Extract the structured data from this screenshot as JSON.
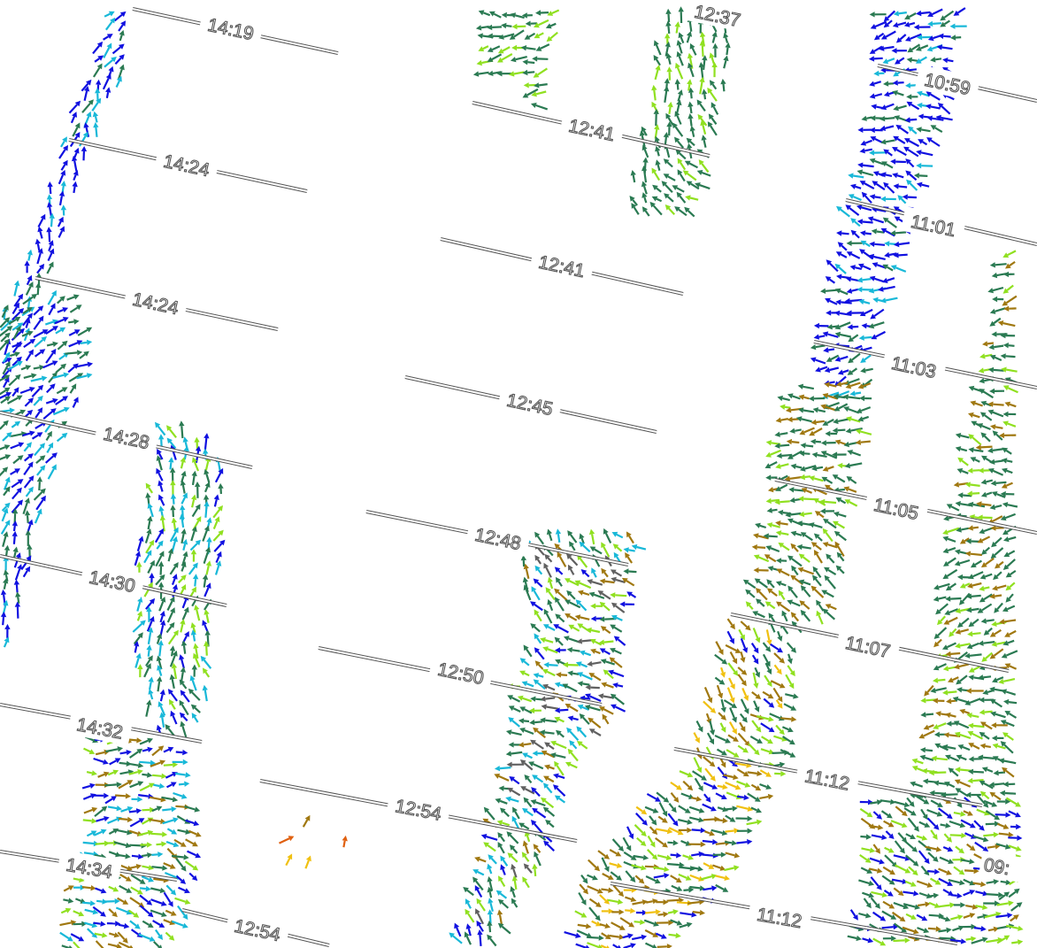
{
  "map": {
    "description_free": true,
    "track_label_color": "#555555",
    "vector_palette": {
      "blue": "#1010e0",
      "cyan": "#18b8d8",
      "dark_green": "#2a7a52",
      "light_green": "#90e020",
      "ochre": "#a07810",
      "yellow": "#f0c010",
      "orange": "#e06010",
      "gray": "#606060"
    },
    "swaths": [
      {
        "id": "A",
        "times": [
          "14:19",
          "14:24",
          "14:24",
          "14:28",
          "14:30",
          "14:32",
          "14:34",
          "12:54"
        ]
      },
      {
        "id": "B",
        "times": [
          "12:37",
          "12:41",
          "12:41",
          "12:45",
          "12:48",
          "12:50",
          "12:54"
        ]
      },
      {
        "id": "C",
        "times": [
          "10:59",
          "11:01",
          "11:03",
          "11:05",
          "11:07",
          "11:12",
          "11:12",
          "09:"
        ]
      }
    ]
  }
}
